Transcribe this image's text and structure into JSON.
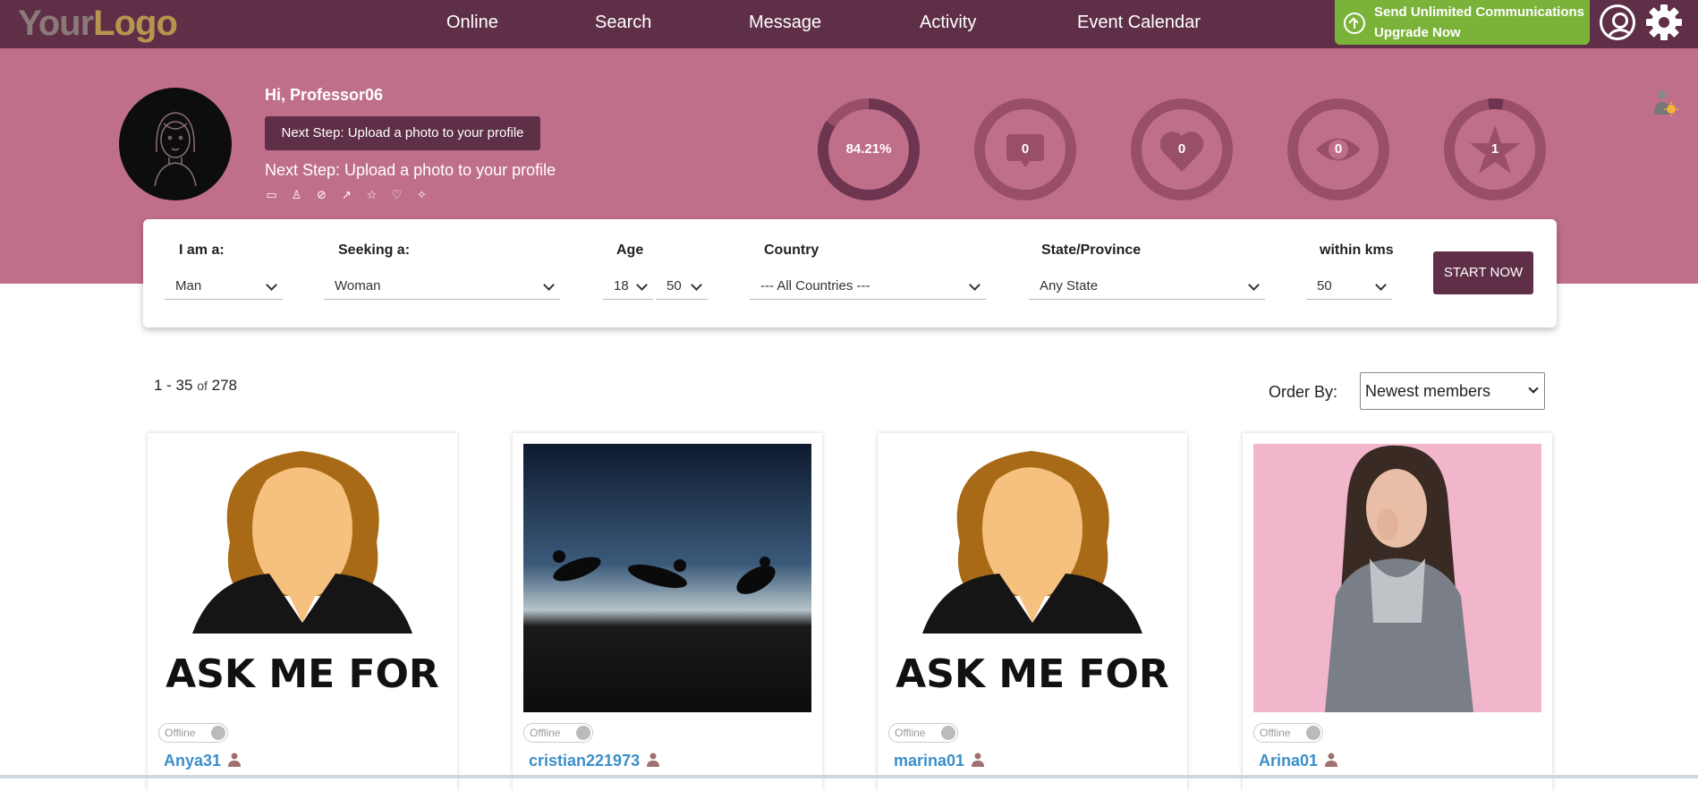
{
  "logo": {
    "part1": "Your",
    "part2": "Logo"
  },
  "nav": {
    "items": [
      "Online",
      "Search",
      "Message",
      "Activity",
      "Event Calendar"
    ]
  },
  "upgrade": {
    "line1": "Send Unlimited Communications",
    "line2": "Upgrade Now"
  },
  "profile": {
    "greeting": "Hi, Professor06",
    "next_step_button": "Next Step: Upload a photo to your profile",
    "next_step_text": "Next Step: Upload a photo to your profile"
  },
  "stats": [
    {
      "value": "84.21%",
      "icon": "profile-progress-icon",
      "progress": 0.8421
    },
    {
      "value": "0",
      "icon": "message-icon"
    },
    {
      "value": "0",
      "icon": "heart-icon"
    },
    {
      "value": "0",
      "icon": "eye-icon"
    },
    {
      "value": "1",
      "icon": "star-icon"
    }
  ],
  "search": {
    "i_am_label": "I am a:",
    "i_am_value": "Man",
    "seeking_label": "Seeking a:",
    "seeking_value": "Woman",
    "age_label": "Age",
    "age_from": "18",
    "age_to": "50",
    "country_label": "Country",
    "country_value": "--- All Countries ---",
    "state_label": "State/Province",
    "state_value": "Any State",
    "within_label": "within kms",
    "within_value": "50",
    "start_button": "START NOW"
  },
  "results": {
    "range": "1 - 35",
    "of": "of",
    "total": "278",
    "order_label": "Order By:",
    "order_value": "Newest members"
  },
  "members": [
    {
      "name": "Anya31",
      "status": "Offline",
      "photo_text": "ASK ME FOR"
    },
    {
      "name": "cristian221973",
      "status": "Offline"
    },
    {
      "name": "marina01",
      "status": "Offline",
      "photo_text": "ASK ME FOR"
    },
    {
      "name": "Arina01",
      "status": "Offline"
    }
  ],
  "colors": {
    "brand": "#5e2f47",
    "hero": "#c06f8b",
    "upgrade": "#7bb33a",
    "link": "#3b8fc9"
  }
}
